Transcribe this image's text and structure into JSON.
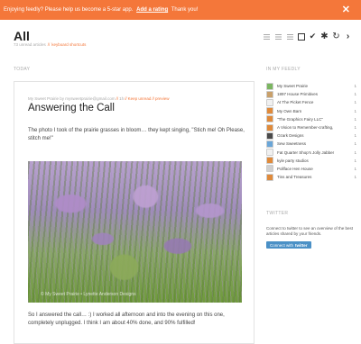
{
  "banner": {
    "message": "Enjoying feedly? Please help us become a 5-star app.",
    "rate_link": "Add a rating",
    "thanks": "Thank you!",
    "close_glyph": "✕"
  },
  "header": {
    "title": "All",
    "unread": "73 unread articles",
    "shortcuts_link": "keyboard shortcuts"
  },
  "toolbar": {
    "check_glyph": "✔",
    "settings_glyph": "✱",
    "refresh_glyph": "↻",
    "next_glyph": "›"
  },
  "sections": {
    "today": "TODAY",
    "my_feedly": "IN MY FEEDLY",
    "twitter": "TWITTER"
  },
  "article": {
    "source": "My Sweet Prairie by mysweetprairie@gmail.com",
    "age": "1h",
    "keep_unread": "Keep unread",
    "preview": "preview",
    "title": "Answering the Call",
    "intro": "The photo I took of the prairie grasses in bloom… they kept singing, \"Stich me! Oh Please, stitch me!\"",
    "photo_watermark": "© My Sweet Prairie • Lynette Anderson Designs",
    "outro": "So I answered the call… :) I worked all afternoon and into the evening on this one, completely unplugged. I think I am about 40% done, and 90% fulfilled!"
  },
  "feeds": [
    {
      "name": "My Sweet Prairie",
      "count": "1",
      "color": "#7bb661"
    },
    {
      "name": "1897 House Primitives",
      "count": "1",
      "color": "#c9a06a"
    },
    {
      "name": "At The Picket Fence",
      "count": "1",
      "color": "#f0f0f0"
    },
    {
      "name": "My Own Barn",
      "count": "1",
      "color": "#e08a3a"
    },
    {
      "name": "\"The Graphics Fairy LLC\"",
      "count": "1",
      "color": "#e08a3a"
    },
    {
      "name": "A Vision to Remember-crafting,",
      "count": "1",
      "color": "#e08a3a"
    },
    {
      "name": "Ozark Designs",
      "count": "1",
      "color": "#4a4a4a"
    },
    {
      "name": "Sew Sweetness",
      "count": "1",
      "color": "#6aa6d8"
    },
    {
      "name": "Fat Quarter Shop's Jolly Jabber",
      "count": "1",
      "color": "#f0f0f0"
    },
    {
      "name": "kyle party studios",
      "count": "1",
      "color": "#e08a3a"
    },
    {
      "name": "Pollface Hen House",
      "count": "1",
      "color": "#d0d0d0"
    },
    {
      "name": "Tins and Treasures",
      "count": "1",
      "color": "#e08a3a"
    }
  ],
  "twitter": {
    "text": "Connect to twitter to see an overview of the best articles shared by your friends.",
    "button_label": "Connect with",
    "button_brand": "twitter"
  },
  "colors": {
    "accent": "#f4773a",
    "twitter_button": "#4a90c6"
  }
}
